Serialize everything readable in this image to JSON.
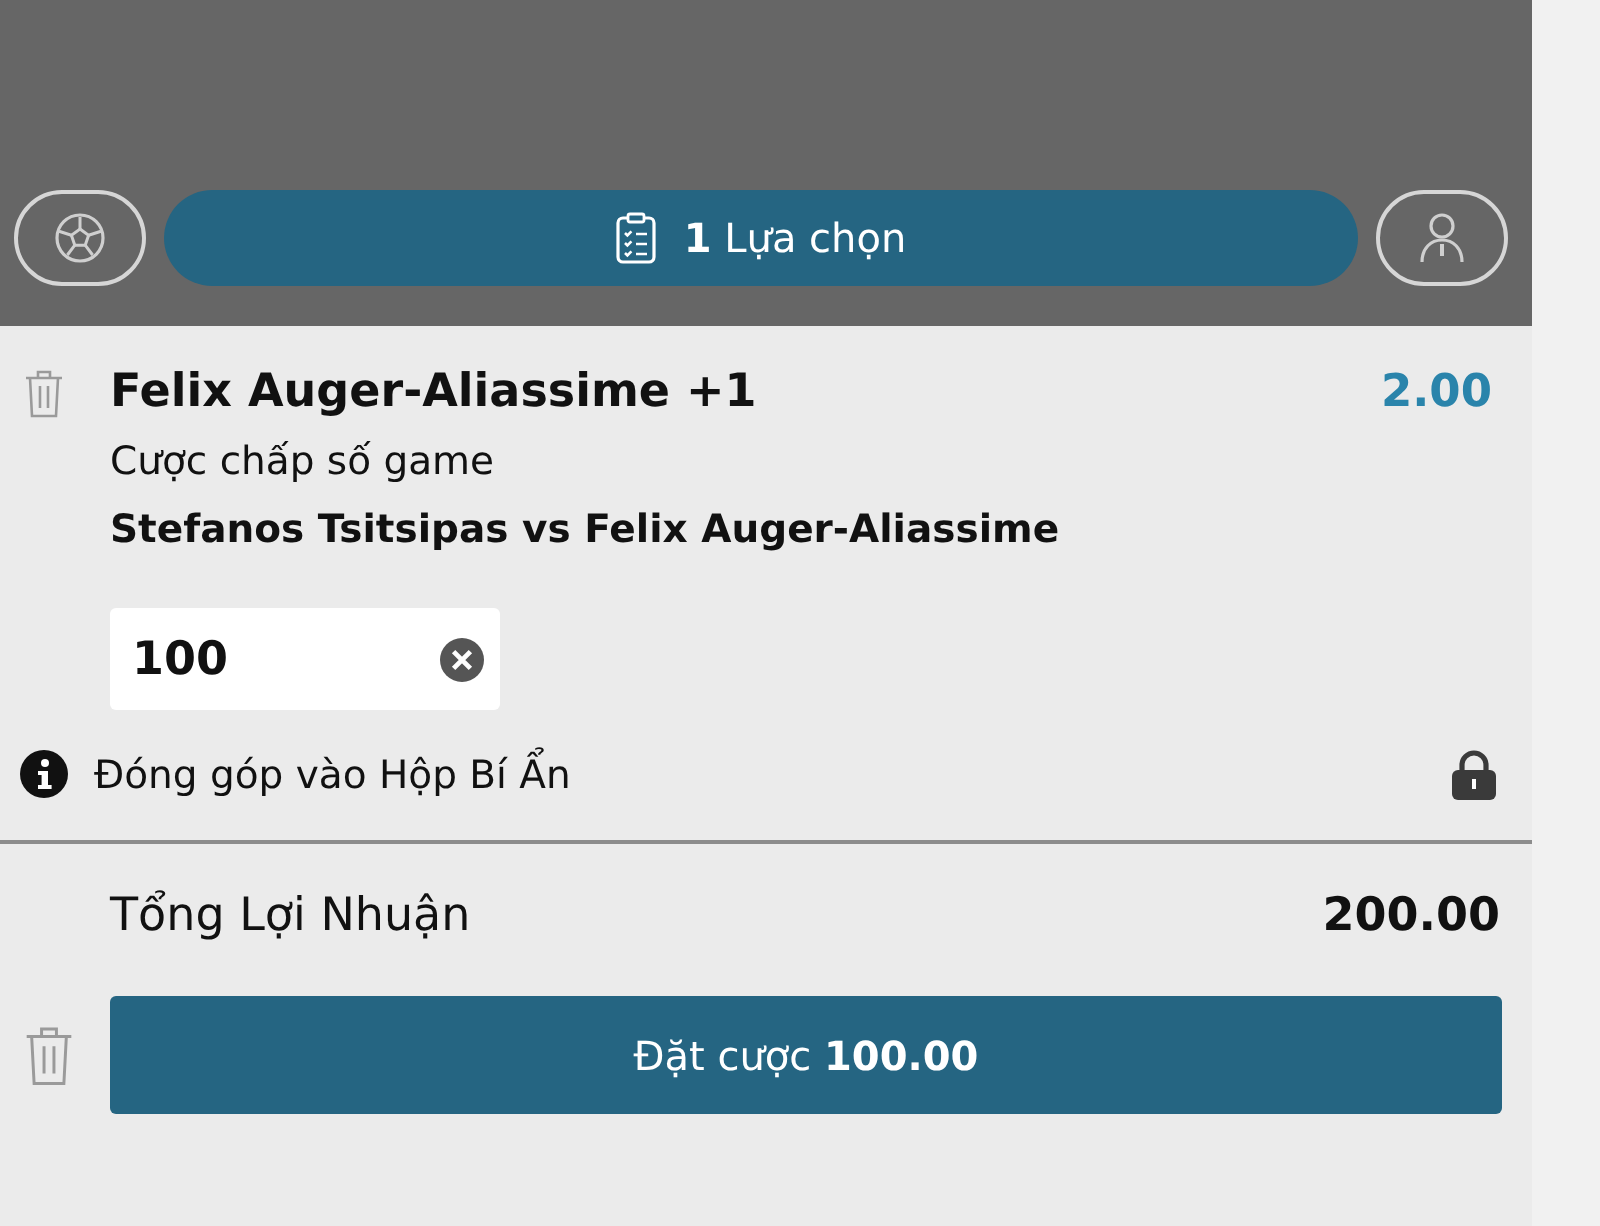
{
  "header": {
    "selection_button": {
      "label": "**1** Lựa chọn"
    }
  },
  "bet": {
    "selection": "Felix Auger-Aliassime +1",
    "odds": "2.00",
    "market": "Cược chấp số game",
    "event": "Stefanos Tsitsipas vs Felix Auger-Aliassime",
    "stake": {
      "value": "100"
    },
    "note": "Đóng góp vào Hộp Bí Ẩn",
    "locked": true
  },
  "summary": {
    "label": "Tổng Lợi Nhuận",
    "value": "200.00"
  },
  "place_button": {
    "label": "Đặt cược **100.00**"
  }
}
